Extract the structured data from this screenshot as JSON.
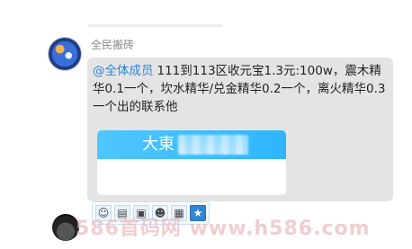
{
  "chat": {
    "message": {
      "sender": "全民搬砖",
      "mention": "@全体成员",
      "text": "111到113区收元宝1.3元:100w，震木精华0.1一个，坎水精华/兑金精华0.2一个，离火精华0.3一个出的联系他",
      "card": {
        "title": "大東"
      }
    },
    "toolbar": {
      "icons": [
        "emoji-icon",
        "document-icon",
        "screenshot-icon",
        "sticker-icon",
        "image-icon",
        "star-icon"
      ]
    }
  },
  "watermark": "586首码网 www.h586.com",
  "colors": {
    "mention": "#2d86d8",
    "bubble": "#e4e4e4",
    "card_header": "#38bcff"
  }
}
